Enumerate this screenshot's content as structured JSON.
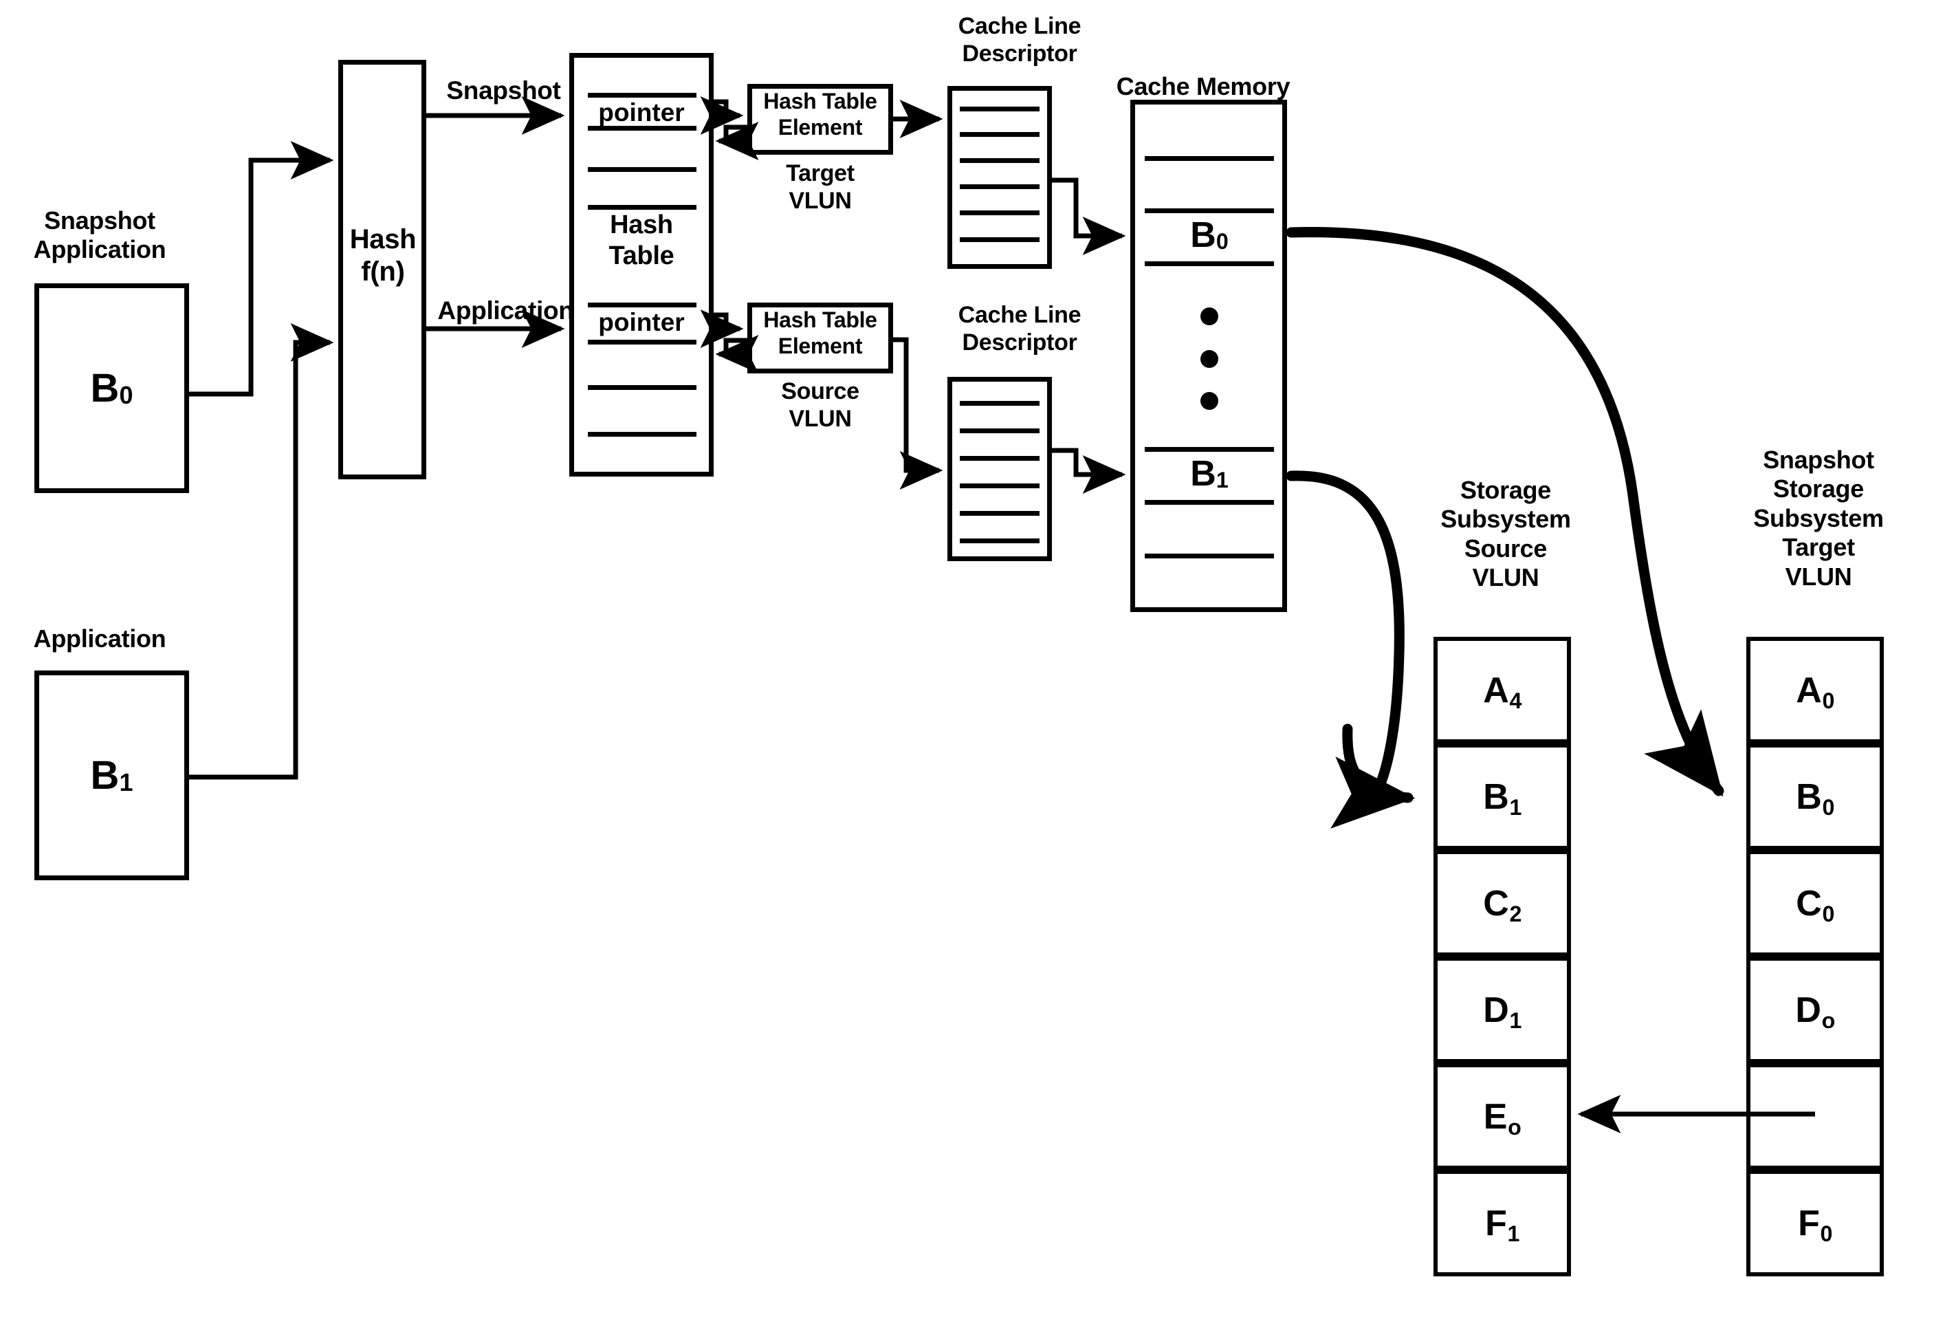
{
  "diagram": {
    "title": "Snapshot copy-on-write cache data flow",
    "labels": {
      "snapshot_application": "Snapshot\nApplication",
      "application": "Application",
      "hash_fn": "Hash\nf(n)",
      "hash_table": "Hash\nTable",
      "pointer": "pointer",
      "edge_snapshot": "Snapshot",
      "edge_application": "Application",
      "hash_table_element": "Hash Table\nElement",
      "target_vlun": "Target\nVLUN",
      "source_vlun": "Source\nVLUN",
      "cache_line_descriptor": "Cache Line\nDescriptor",
      "cache_memory": "Cache Memory",
      "storage_subsystem_source": "Storage\nSubsystem\nSource\nVLUN",
      "snapshot_storage_subsystem_target": "Snapshot\nStorage\nSubsystem\nTarget\nVLUN"
    },
    "app_blocks": [
      {
        "name": "snapshot-application-block",
        "base": "B",
        "sub": "0"
      },
      {
        "name": "application-block",
        "base": "B",
        "sub": "1"
      }
    ],
    "cache_memory_blocks": [
      {
        "name": "cache-block-b0",
        "base": "B",
        "sub": "0"
      },
      {
        "name": "cache-block-b1",
        "base": "B",
        "sub": "1"
      }
    ],
    "source_vlun_cells": [
      {
        "base": "A",
        "sub": "4"
      },
      {
        "base": "B",
        "sub": "1"
      },
      {
        "base": "C",
        "sub": "2"
      },
      {
        "base": "D",
        "sub": "1"
      },
      {
        "base": "E",
        "sub": "o"
      },
      {
        "base": "F",
        "sub": "1"
      }
    ],
    "target_vlun_cells": [
      {
        "base": "A",
        "sub": "0"
      },
      {
        "base": "B",
        "sub": "0"
      },
      {
        "base": "C",
        "sub": "0"
      },
      {
        "base": "D",
        "sub": "o"
      },
      {
        "base": "",
        "sub": ""
      },
      {
        "base": "F",
        "sub": "0"
      }
    ],
    "colors": {
      "stroke": "#000000",
      "background": "#ffffff"
    }
  }
}
